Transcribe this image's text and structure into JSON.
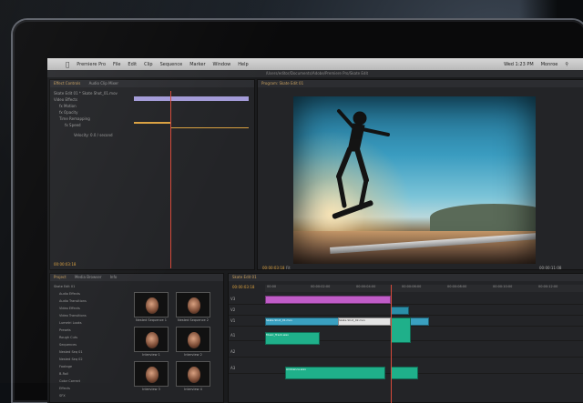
{
  "menubar": {
    "items": [
      "Premiere Pro",
      "File",
      "Edit",
      "Clip",
      "Sequence",
      "Marker",
      "Window",
      "Help"
    ],
    "clock": "Wed 1:23 PM",
    "user": "Monroe"
  },
  "window_title": "/Users/editor/Documents/Adobe/Premiere Pro/Skate Edit",
  "effect_controls": {
    "tabs": [
      "Effect Controls",
      "Audio Clip Mixer"
    ],
    "rows": [
      "Skate Edit 01 * Skate Shot_01.mov",
      "Video Effects",
      "fx Motion",
      "fx Opacity",
      "Time Remapping",
      "fx Speed",
      "Velocity: 0.0 / second",
      "00:00:03:18"
    ],
    "timecode": "00:00:03:18"
  },
  "program": {
    "tab": "Program: Skate Edit 01",
    "timecode": "00:00:03:18",
    "fit": "Fit",
    "duration": "00:00:11:08"
  },
  "project": {
    "tabs": [
      "Project",
      "Media Browser",
      "Info"
    ],
    "items": [
      "Skate Edit 01",
      "Audio Effects",
      "Audio Transitions",
      "Video Effects",
      "Video Transitions",
      "Lumetri Looks",
      "Presets",
      "Rough Cuts",
      "Sequences",
      "Nested Seq 01",
      "Nested Seq 02",
      "Footage",
      "B-Roll",
      "Color Correct",
      "Effects",
      "SFX"
    ],
    "thumbs": [
      "Nested Sequence 1",
      "Nested Sequence 2",
      "Interview 1",
      "Interview 2",
      "Interview 3",
      "Interview 4"
    ]
  },
  "timeline": {
    "tab": "Skate Edit 01",
    "timecode": "00:00:03:18",
    "ruler": [
      "00:00",
      "00:00:02:00",
      "00:00:04:00",
      "00:00:06:00",
      "00:00:08:00",
      "00:00:10:00",
      "00:00:12:00"
    ],
    "tracks": [
      "V3",
      "V2",
      "V1",
      "A1",
      "A2",
      "A3"
    ],
    "clips": [
      "Skate Shot_01.mov",
      "Skate Shot_02.mov",
      "Music_Track.wav",
      "Ambience.wav"
    ]
  },
  "colors": {
    "accent": "#d9a040",
    "video_clip": "#3aa0c0",
    "audio_clip": "#1fb08a",
    "nested_clip": "#c05cc8",
    "playhead": "#d64a3a"
  }
}
